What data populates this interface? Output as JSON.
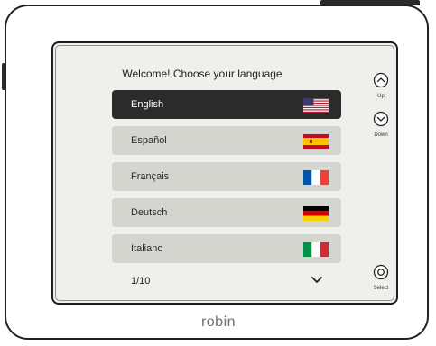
{
  "screen": {
    "title": "Welcome! Choose your language",
    "languages": [
      {
        "label": "English",
        "flag": "us-flag",
        "selected": true
      },
      {
        "label": "Español",
        "flag": "spain-flag",
        "selected": false
      },
      {
        "label": "Français",
        "flag": "france-flag",
        "selected": false
      },
      {
        "label": "Deutsch",
        "flag": "germany-flag",
        "selected": false
      },
      {
        "label": "Italiano",
        "flag": "italy-flag",
        "selected": false
      }
    ],
    "pager": "1/10"
  },
  "buttons": {
    "up": "Up",
    "down": "Down",
    "select": "Select"
  },
  "brand": "robin",
  "colors": {
    "selected_row": "#2b2b2b",
    "row": "#d5d5d0",
    "screen_bg": "#efefec"
  }
}
